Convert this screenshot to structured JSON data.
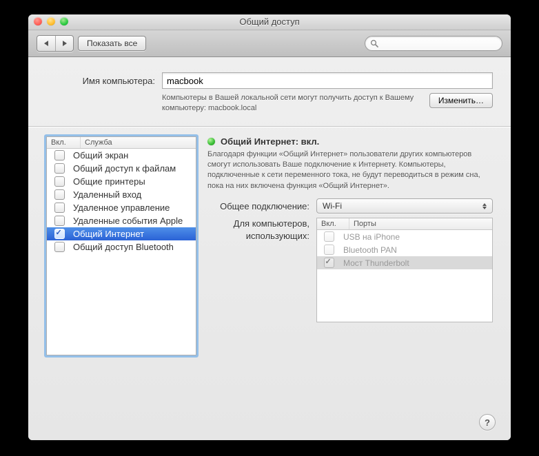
{
  "window": {
    "title": "Общий доступ"
  },
  "toolbar": {
    "show_all": "Показать все",
    "search_placeholder": ""
  },
  "computer": {
    "label": "Имя компьютера:",
    "value": "macbook",
    "hint": "Компьютеры в Вашей локальной сети могут получить доступ к Вашему компьютеру: macbook.local",
    "edit_button": "Изменить…"
  },
  "services": {
    "col_on": "Вкл.",
    "col_service": "Служба",
    "items": [
      {
        "on": false,
        "label": "Общий экран"
      },
      {
        "on": false,
        "label": "Общий доступ к файлам"
      },
      {
        "on": false,
        "label": "Общие принтеры"
      },
      {
        "on": false,
        "label": "Удаленный вход"
      },
      {
        "on": false,
        "label": "Удаленное управление"
      },
      {
        "on": false,
        "label": "Удаленные события Apple"
      },
      {
        "on": true,
        "label": "Общий Интернет"
      },
      {
        "on": false,
        "label": "Общий доступ Bluetooth"
      }
    ],
    "selected_index": 6
  },
  "detail": {
    "status_title": "Общий Интернет: вкл.",
    "description": "Благодаря функции «Общий Интернет» пользователи других компьютеров смогут использовать Ваше подключение к Интернету. Компьютеры, подключенные к сети переменного тока, не будут переводиться в режим сна, пока на них включена функция «Общий Интернет».",
    "share_from_label": "Общее подключение:",
    "share_from_value": "Wi-Fi",
    "share_to_label_1": "Для компьютеров,",
    "share_to_label_2": "использующих:",
    "ports": {
      "col_on": "Вкл.",
      "col_port": "Порты",
      "items": [
        {
          "on": false,
          "label": "USB на iPhone",
          "disabled": true
        },
        {
          "on": false,
          "label": "Bluetooth PAN",
          "disabled": true
        },
        {
          "on": true,
          "label": "Мост Thunderbolt",
          "disabled": true
        }
      ],
      "selected_index": 2
    }
  },
  "help_tooltip": "?"
}
